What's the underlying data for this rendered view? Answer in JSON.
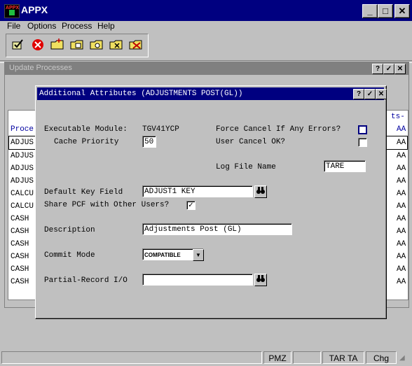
{
  "window": {
    "title": "APPX",
    "icon_text": "APPX",
    "controls": [
      "_",
      "□",
      "✕"
    ]
  },
  "menu": [
    {
      "label": "File"
    },
    {
      "label": "Options"
    },
    {
      "label": "Process"
    },
    {
      "label": "Help"
    }
  ],
  "toolbar": {
    "icons": [
      "check-icon",
      "cancel-icon",
      "folder-new-icon",
      "folder-open-icon",
      "folder-search-icon",
      "folder-close-icon",
      "folder-delete-icon"
    ]
  },
  "background_window": {
    "title": "Update Processes",
    "controls": [
      "?",
      "✓",
      "✕"
    ],
    "left_header": "Proce",
    "left_rows": [
      "ADJUS",
      "ADJUS",
      "ADJUS",
      "ADJUS",
      "CALCU",
      "CALCU",
      "CASH",
      "CASH",
      "CASH",
      "CASH",
      "CASH",
      "CASH"
    ],
    "right_header_top": "ts-",
    "right_header": "AA",
    "right_rows": [
      "AA",
      "AA",
      "AA",
      "AA",
      "AA",
      "AA",
      "AA",
      "AA",
      "AA",
      "AA",
      "AA",
      "AA"
    ]
  },
  "dialog": {
    "title": "Additional Attributes (ADJUSTMENTS POST(GL))",
    "controls": [
      "?",
      "✓",
      "✕"
    ],
    "executable_module_label": "Executable Module:",
    "executable_module_value": "TGV41YCP",
    "cache_priority_label": "Cache Priority",
    "cache_priority_value": "50",
    "force_cancel_label": "Force Cancel If Any Errors?",
    "force_cancel_checked": false,
    "user_cancel_label": "User Cancel OK?",
    "user_cancel_checked": false,
    "log_file_label": "Log File Name",
    "log_file_value": "TARE",
    "default_key_label": "Default Key Field",
    "default_key_value": "ADJUST1 KEY",
    "share_pcf_label": "Share PCF with Other Users?",
    "share_pcf_mark": "✓",
    "description_label": "Description",
    "description_value": "Adjustments Post (GL)",
    "commit_mode_label": "Commit Mode",
    "commit_mode_value": "COMPATIBLE",
    "partial_record_label": "Partial-Record I/O",
    "partial_record_value": ""
  },
  "status_bar": {
    "cells": [
      "",
      "PMZ",
      "",
      "TAR TA",
      "Chg"
    ]
  }
}
